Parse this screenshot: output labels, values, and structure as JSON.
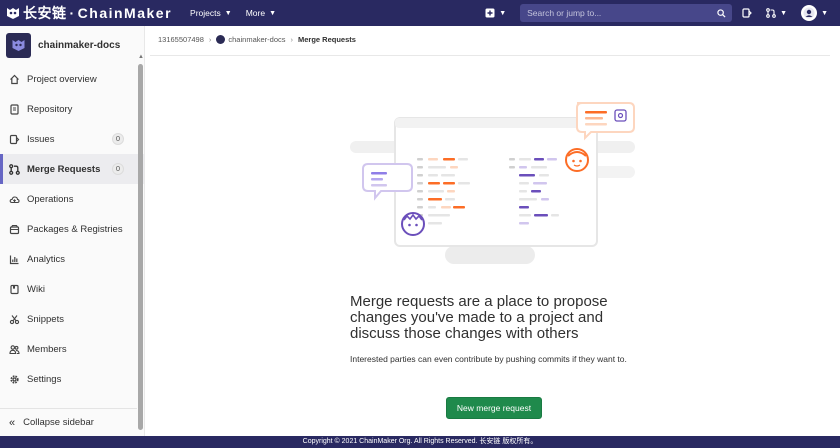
{
  "topbar": {
    "brand_cn": "长安链",
    "brand_dot": "·",
    "brand_en": "ChainMaker",
    "nav": [
      {
        "label": "Projects"
      },
      {
        "label": "More"
      }
    ],
    "search_placeholder": "Search or jump to...",
    "icons": [
      "plus-square-icon",
      "search-icon",
      "issues-icon",
      "merge-request-icon",
      "user-avatar"
    ]
  },
  "sidebar": {
    "project_name": "chainmaker-docs",
    "items": [
      {
        "label": "Project overview",
        "icon": "home-icon"
      },
      {
        "label": "Repository",
        "icon": "doc-icon"
      },
      {
        "label": "Issues",
        "icon": "issues-icon",
        "count": "0"
      },
      {
        "label": "Merge Requests",
        "icon": "merge-request-icon",
        "count": "0",
        "active": true
      },
      {
        "label": "Operations",
        "icon": "cloud-icon"
      },
      {
        "label": "Packages & Registries",
        "icon": "package-icon"
      },
      {
        "label": "Analytics",
        "icon": "chart-icon"
      },
      {
        "label": "Wiki",
        "icon": "book-icon"
      },
      {
        "label": "Snippets",
        "icon": "scissors-icon"
      },
      {
        "label": "Members",
        "icon": "users-icon"
      },
      {
        "label": "Settings",
        "icon": "gear-icon"
      }
    ],
    "collapse_label": "Collapse sidebar"
  },
  "breadcrumb": {
    "group": "13165507498",
    "project": "chainmaker-docs",
    "current": "Merge Requests"
  },
  "empty_state": {
    "title": "Merge requests are a place to propose changes you've made to a project and discuss those changes with others",
    "description": "Interested parties can even contribute by pushing commits if they want to.",
    "button_label": "New merge request"
  },
  "footer": {
    "text": "Copyright © 2021 ChainMaker Org. All Rights Reserved. 长安链 版权所有。"
  },
  "colors": {
    "topbar": "#292961",
    "active_accent": "#6666c4",
    "button_green": "#1f8a4c",
    "illustration_orange": "#fc6d26",
    "illustration_purple": "#6b4fbb"
  }
}
